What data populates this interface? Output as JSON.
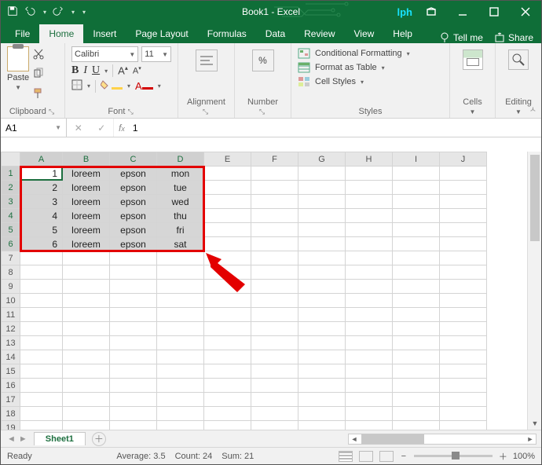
{
  "title": "Book1 - Excel",
  "logo": "lph",
  "qat": {
    "save": "save-icon",
    "undo": "undo-icon",
    "redo": "redo-icon"
  },
  "tabs": [
    "File",
    "Home",
    "Insert",
    "Page Layout",
    "Formulas",
    "Data",
    "Review",
    "View",
    "Help"
  ],
  "active_tab": "Home",
  "tellme": "Tell me",
  "share": "Share",
  "ribbon": {
    "clipboard": {
      "paste": "Paste",
      "label": "Clipboard"
    },
    "font": {
      "name": "Calibri",
      "size": "11",
      "label": "Font",
      "bold": "B",
      "italic": "I",
      "underline": "U",
      "grow": "A",
      "shrink": "A"
    },
    "alignment": {
      "label": "Alignment"
    },
    "number": {
      "label": "Number",
      "percent": "%"
    },
    "styles": {
      "cond": "Conditional Formatting",
      "table": "Format as Table",
      "cell": "Cell Styles",
      "label": "Styles"
    },
    "cells": {
      "label": "Cells"
    },
    "editing": {
      "label": "Editing"
    }
  },
  "namebox": "A1",
  "formula": "1",
  "columns": [
    "A",
    "B",
    "C",
    "D",
    "E",
    "F",
    "G",
    "H",
    "I",
    "J"
  ],
  "rows": 19,
  "data": [
    [
      "1",
      "loreem",
      "epson",
      "mon"
    ],
    [
      "2",
      "loreem",
      "epson",
      "tue"
    ],
    [
      "3",
      "loreem",
      "epson",
      "wed"
    ],
    [
      "4",
      "loreem",
      "epson",
      "thu"
    ],
    [
      "5",
      "loreem",
      "epson",
      "fri"
    ],
    [
      "6",
      "loreem",
      "epson",
      "sat"
    ]
  ],
  "sheet_tab": "Sheet1",
  "status": {
    "ready": "Ready",
    "average": "Average: 3.5",
    "count": "Count: 24",
    "sum": "Sum: 21",
    "zoom": "100%"
  }
}
